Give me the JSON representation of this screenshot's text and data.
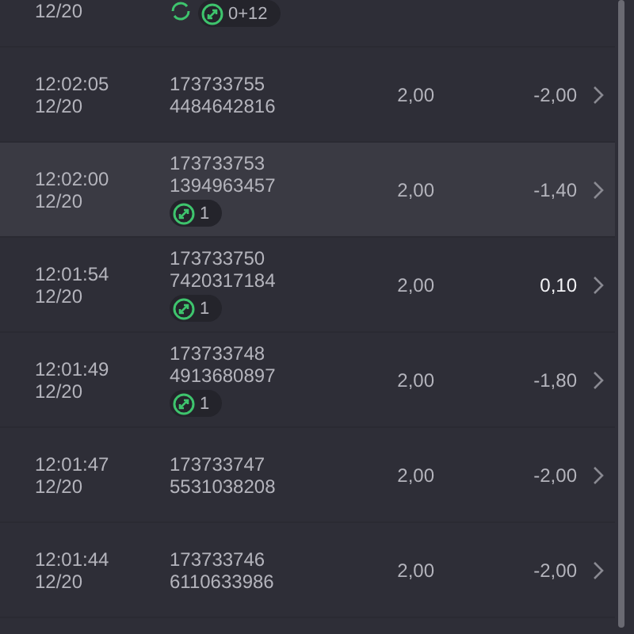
{
  "partial_row": {
    "date": "12/20",
    "badges": [
      {
        "kind": "refresh"
      },
      {
        "kind": "swap",
        "count": "0+12"
      }
    ]
  },
  "rows": [
    {
      "time": "12:02:05",
      "date": "12/20",
      "id_line_1": "173733755",
      "id_line_2": "4484642816",
      "badges": [],
      "stake": "2,00",
      "result": "-2,00",
      "positive": false,
      "selected": false
    },
    {
      "time": "12:02:00",
      "date": "12/20",
      "id_line_1": "173733753",
      "id_line_2": "1394963457",
      "badges": [
        {
          "kind": "swap",
          "count": "1"
        }
      ],
      "stake": "2,00",
      "result": "-1,40",
      "positive": false,
      "selected": true
    },
    {
      "time": "12:01:54",
      "date": "12/20",
      "id_line_1": "173733750",
      "id_line_2": "7420317184",
      "badges": [
        {
          "kind": "swap",
          "count": "1"
        }
      ],
      "stake": "2,00",
      "result": "0,10",
      "positive": true,
      "selected": false
    },
    {
      "time": "12:01:49",
      "date": "12/20",
      "id_line_1": "173733748",
      "id_line_2": "4913680897",
      "badges": [
        {
          "kind": "swap",
          "count": "1"
        }
      ],
      "stake": "2,00",
      "result": "-1,80",
      "positive": false,
      "selected": false
    },
    {
      "time": "12:01:47",
      "date": "12/20",
      "id_line_1": "173733747",
      "id_line_2": "5531038208",
      "badges": [],
      "stake": "2,00",
      "result": "-2,00",
      "positive": false,
      "selected": false
    },
    {
      "time": "12:01:44",
      "date": "12/20",
      "id_line_1": "173733746",
      "id_line_2": "6110633986",
      "badges": [],
      "stake": "2,00",
      "result": "-2,00",
      "positive": false,
      "selected": false
    }
  ]
}
